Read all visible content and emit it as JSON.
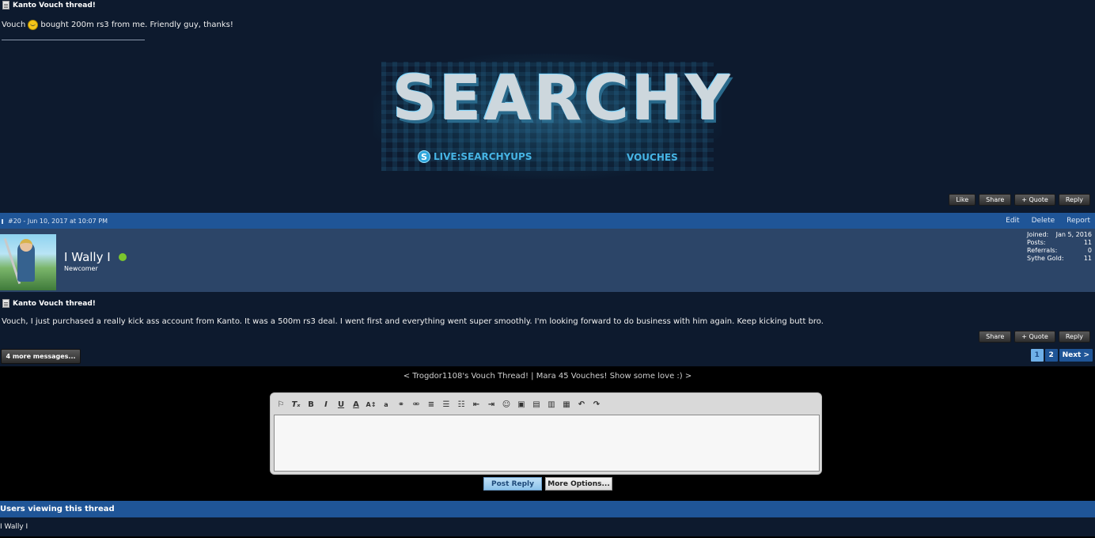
{
  "post1": {
    "title": "Kanto Vouch thread!",
    "body_before": "Vouch",
    "body_after": "bought 200m rs3 from me. Friendly guy, thanks!",
    "signature": {
      "banner_title": "SEARCHY",
      "skype_text": "LIVE:SEARCHYUPS",
      "vouches_text": "VOUCHES"
    },
    "buttons": [
      "Like",
      "Share",
      "+ Quote",
      "Reply"
    ]
  },
  "post2": {
    "header": {
      "number_date": "#20 - Jun 10, 2017 at 10:07 PM",
      "actions": [
        "Edit",
        "Delete",
        "Report"
      ]
    },
    "user": {
      "name": "I Wally I",
      "rank": "Newcomer",
      "online": true,
      "stats": [
        {
          "label": "Joined:",
          "value": "Jan 5, 2016"
        },
        {
          "label": "Posts:",
          "value": "11"
        },
        {
          "label": "Referrals:",
          "value": "0"
        },
        {
          "label": "Sythe Gold:",
          "value": "11"
        }
      ]
    },
    "title": "Kanto Vouch thread!",
    "body": "Vouch, I just purchased a really kick ass account from Kanto. It was a 500m rs3 deal. I went first and everything went super smoothly. I'm looking forward to do business with him again. Keep kicking butt bro.",
    "buttons": [
      "Share",
      "+ Quote",
      "Reply"
    ]
  },
  "more_messages": "4 more messages...",
  "pagination": {
    "pages": [
      "1",
      "2"
    ],
    "current": "1",
    "next": "Next >"
  },
  "thread_nav": "< Trogdor1108's Vouch Thread! | Mara 45 Vouches! Show some love :) >",
  "editor": {
    "toolbar_icons": [
      "remove-format-icon",
      "clear-format-icon",
      "bold-icon",
      "italic-icon",
      "underline-icon",
      "font-color-icon",
      "font-size-icon",
      "font-family-icon",
      "link-icon",
      "unlink-icon",
      "align-icon",
      "bullet-list-icon",
      "numbered-list-icon",
      "outdent-icon",
      "indent-icon",
      "smiley-icon",
      "image-icon",
      "media-icon",
      "code-icon",
      "save-draft-icon",
      "undo-icon",
      "redo-icon"
    ],
    "value": ""
  },
  "submit": {
    "post_reply": "Post Reply",
    "more_options": "More Options..."
  },
  "viewers": {
    "heading": "Users viewing this thread",
    "list": "I Wally I"
  },
  "colors": {
    "post_bg": "#0d1a2e",
    "header_blue": "#1f5597",
    "user_block": "#2c4568",
    "online": "#7cc62e"
  }
}
